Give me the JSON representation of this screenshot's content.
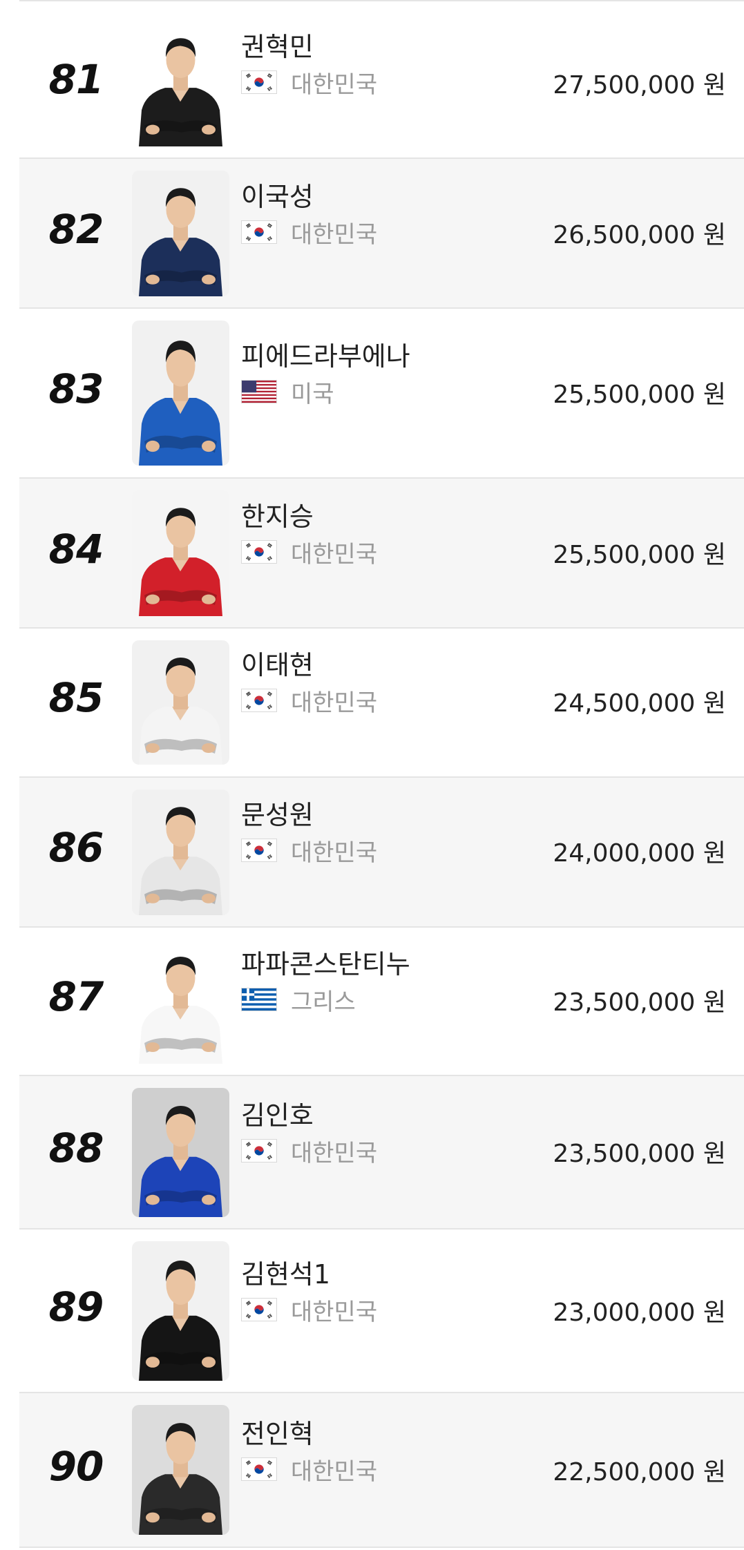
{
  "ranking": {
    "rows": [
      {
        "rank": "81",
        "name": "권혁민",
        "country": "대한민국",
        "flag": "korea-flag",
        "prize": "27,500,000 원",
        "jersey": "#1c1c1c",
        "photo_bg": "#ffffff"
      },
      {
        "rank": "82",
        "name": "이국성",
        "country": "대한민국",
        "flag": "korea-flag",
        "prize": "26,500,000 원",
        "jersey": "#1c2f5a",
        "photo_bg": "#f1f1f1"
      },
      {
        "rank": "83",
        "name": "피에드라부에나",
        "country": "미국",
        "flag": "usa-flag",
        "prize": "25,500,000 원",
        "jersey": "#1f5fbf",
        "photo_bg": "#f1f1f1"
      },
      {
        "rank": "84",
        "name": "한지승",
        "country": "대한민국",
        "flag": "korea-flag",
        "prize": "25,500,000 원",
        "jersey": "#d2202a",
        "photo_bg": "#f5f5f5"
      },
      {
        "rank": "85",
        "name": "이태현",
        "country": "대한민국",
        "flag": "korea-flag",
        "prize": "24,500,000 원",
        "jersey": "#f4f4f4",
        "photo_bg": "#f1f1f1"
      },
      {
        "rank": "86",
        "name": "문성원",
        "country": "대한민국",
        "flag": "korea-flag",
        "prize": "24,000,000 원",
        "jersey": "#e6e6e6",
        "photo_bg": "#f1f1f1"
      },
      {
        "rank": "87",
        "name": "파파콘스탄티누",
        "country": "그리스",
        "flag": "greece-flag",
        "prize": "23,500,000 원",
        "jersey": "#f7f7f7",
        "photo_bg": "#ffffff"
      },
      {
        "rank": "88",
        "name": "김인호",
        "country": "대한민국",
        "flag": "korea-flag",
        "prize": "23,500,000 원",
        "jersey": "#1d44b8",
        "photo_bg": "#cfcfcf"
      },
      {
        "rank": "89",
        "name": "김현석1",
        "country": "대한민국",
        "flag": "korea-flag",
        "prize": "23,000,000 원",
        "jersey": "#151515",
        "photo_bg": "#f1f1f1"
      },
      {
        "rank": "90",
        "name": "전인혁",
        "country": "대한민국",
        "flag": "korea-flag",
        "prize": "22,500,000 원",
        "jersey": "#2a2a2a",
        "photo_bg": "#dcdcdc"
      }
    ]
  }
}
